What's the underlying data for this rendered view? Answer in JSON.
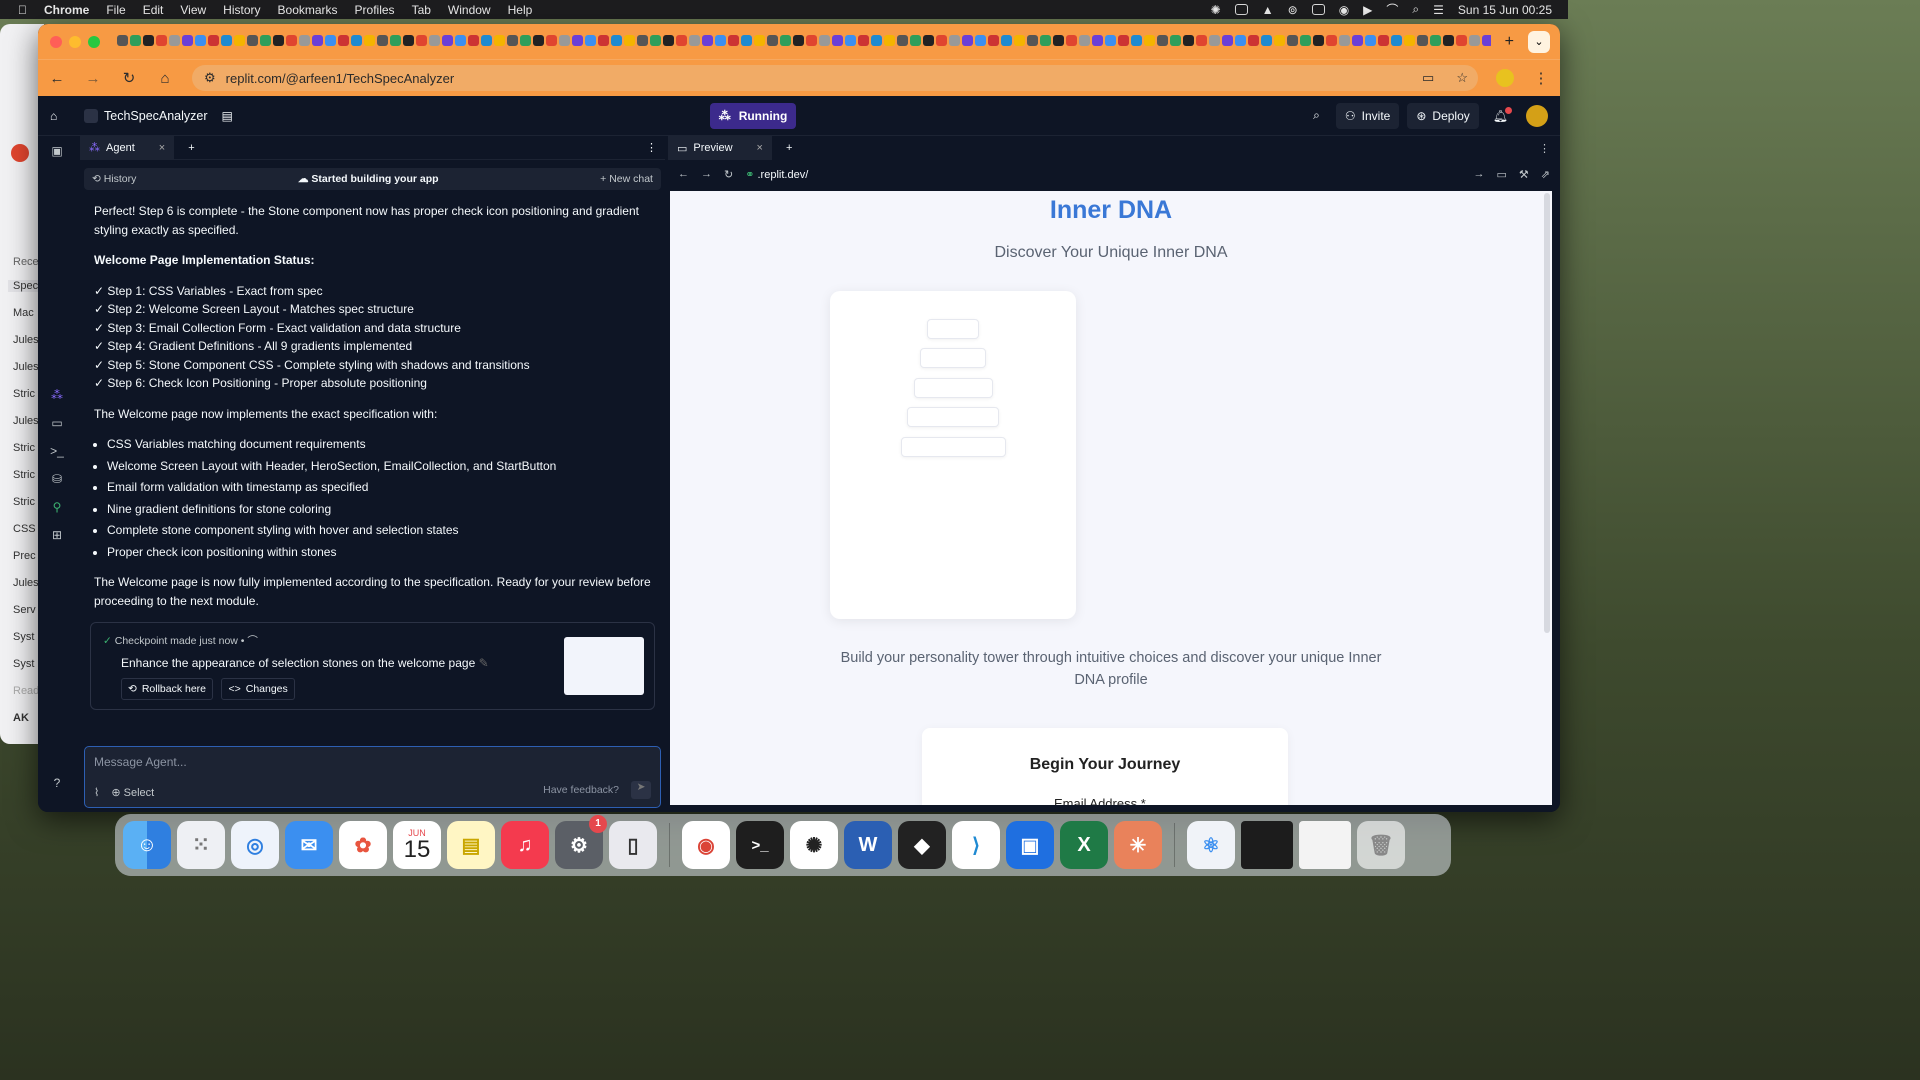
{
  "menubar": {
    "app": "Chrome",
    "items": [
      "File",
      "Edit",
      "View",
      "History",
      "Bookmarks",
      "Profiles",
      "Tab",
      "Window",
      "Help"
    ],
    "clock": "Sun 15 Jun  00:25"
  },
  "ghost": {
    "items": [
      "Recen",
      "Spec",
      "Mac",
      "Jules",
      "Jules",
      "Stric",
      "Jules",
      "Stric",
      "Stric",
      "Stric",
      "CSS",
      "Prec",
      "Jules",
      "Serv",
      "Syst",
      "Syst",
      "Read"
    ],
    "avatar": "AK"
  },
  "browser": {
    "url": "replit.com/@arfeen1/TechSpecAnalyzer"
  },
  "replit": {
    "project": "TechSpecAnalyzer",
    "status": "Running",
    "invite": "Invite",
    "deploy": "Deploy"
  },
  "agent": {
    "tab": "Agent",
    "history": "History",
    "session": "Started building your app",
    "new_chat": "New chat",
    "intro": "Perfect! Step 6 is complete - the Stone component now has proper check icon positioning and gradient styling exactly as specified.",
    "status_heading": "Welcome Page Implementation Status:",
    "steps": [
      "✓ Step 1: CSS Variables - Exact from spec",
      "✓ Step 2: Welcome Screen Layout - Matches spec structure",
      "✓ Step 3: Email Collection Form - Exact validation and data structure",
      "✓ Step 4: Gradient Definitions - All 9 gradients implemented",
      "✓ Step 5: Stone Component CSS - Complete styling with shadows and transitions",
      "✓ Step 6: Check Icon Positioning - Proper absolute positioning"
    ],
    "impl_heading": "The Welcome page now implements the exact specification with:",
    "bullets": [
      "CSS Variables matching document requirements",
      "Welcome Screen Layout with Header, HeroSection, EmailCollection, and StartButton",
      "Email form validation with timestamp as specified",
      "Nine gradient definitions for stone coloring",
      "Complete stone component styling with hover and selection states",
      "Proper check icon positioning within stones"
    ],
    "outro": "The Welcome page is now fully implemented according to the specification. Ready for your review before proceeding to the next module.",
    "checkpoint": {
      "meta": "Checkpoint made just now",
      "title": "Enhance the appearance of selection stones on the welcome page",
      "rollback": "Rollback here",
      "changes": "Changes"
    },
    "input_placeholder": "Message Agent...",
    "select": "Select",
    "feedback": "Have feedback?"
  },
  "preview": {
    "tab": "Preview",
    "url": ".replit.dev/",
    "title": "Inner DNA",
    "subtitle": "Discover Your Unique Inner DNA",
    "desc": "Build your personality tower through intuitive choices and discover your unique Inner DNA profile",
    "journey": "Begin Your Journey",
    "email_label": "Email Address *"
  },
  "dock": {
    "calendar_month": "JUN",
    "calendar_day": "15",
    "badge": "1"
  }
}
